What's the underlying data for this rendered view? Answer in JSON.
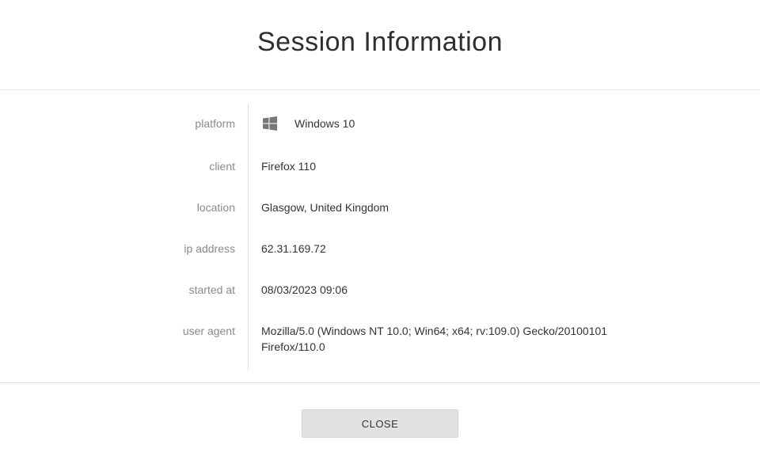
{
  "dialog": {
    "title": "Session Information",
    "rows": [
      {
        "label": "platform",
        "value": "Windows 10",
        "icon": "windows-icon"
      },
      {
        "label": "client",
        "value": "Firefox 110"
      },
      {
        "label": "location",
        "value": "Glasgow, United Kingdom"
      },
      {
        "label": "ip address",
        "value": "62.31.169.72"
      },
      {
        "label": "started at",
        "value": "08/03/2023 09:06"
      },
      {
        "label": "user agent",
        "value": "Mozilla/5.0 (Windows NT 10.0; Win64; x64; rv:109.0) Gecko/20100101 Firefox/110.0"
      }
    ],
    "close_label": "CLOSE"
  },
  "colors": {
    "label": "#8a8a8a",
    "value": "#333333",
    "button_bg": "#e2e2e2",
    "divider": "#e2e2e2",
    "icon": "#777777"
  }
}
